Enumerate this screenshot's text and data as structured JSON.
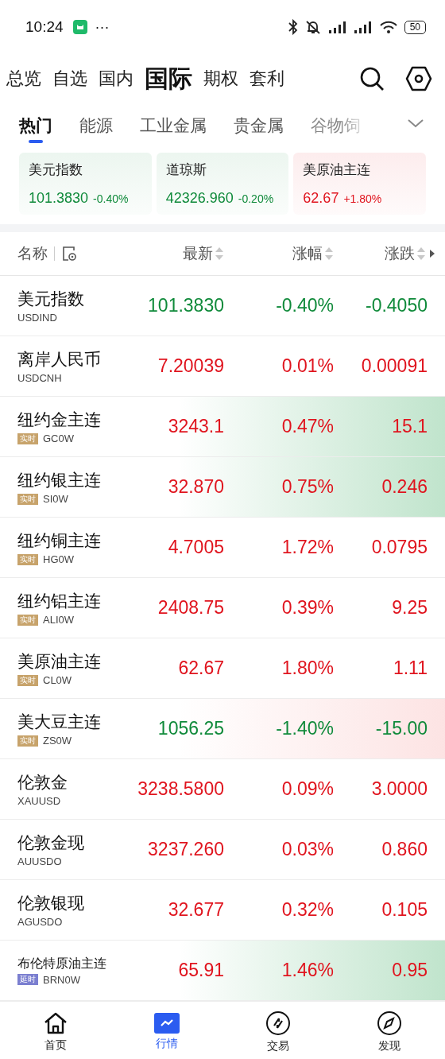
{
  "status_bar": {
    "time": "10:24",
    "more": "···",
    "battery": "50"
  },
  "top_tabs": [
    {
      "label": "总览",
      "selected": false
    },
    {
      "label": "自选",
      "selected": false
    },
    {
      "label": "国内",
      "selected": false
    },
    {
      "label": "国际",
      "selected": true
    },
    {
      "label": "期权",
      "selected": false
    },
    {
      "label": "套利",
      "selected": false
    }
  ],
  "category_tabs": [
    {
      "label": "热门",
      "selected": true
    },
    {
      "label": "能源",
      "selected": false
    },
    {
      "label": "工业金属",
      "selected": false
    },
    {
      "label": "贵金属",
      "selected": false
    },
    {
      "label": "谷物饲",
      "selected": false
    }
  ],
  "index_cards": [
    {
      "name": "美元指数",
      "price": "101.3830",
      "change": "-0.40%",
      "color": "#0f8a3a"
    },
    {
      "name": "道琼斯",
      "price": "42326.960",
      "change": "-0.20%",
      "color": "#0f8a3a"
    },
    {
      "name": "美原油主连",
      "price": "62.67",
      "change": "+1.80%",
      "color": "#e0141e"
    }
  ],
  "table": {
    "columns": [
      "名称",
      "最新",
      "涨幅",
      "涨跌"
    ],
    "rows": [
      {
        "name": "美元指数",
        "code": "USDIND",
        "price": "101.3830",
        "pct": "-0.40%",
        "change": "-0.4050",
        "color": "#0f8a3a",
        "kind": "plain"
      },
      {
        "name": "离岸人民币",
        "code": "USDCNH",
        "price": "7.20039",
        "pct": "0.01%",
        "change": "0.00091",
        "color": "#e0141e",
        "kind": "plain"
      },
      {
        "name": "纽约金主连",
        "code": "GC0W",
        "tag": {
          "text": "实时",
          "kind": "live"
        },
        "price": "3243.1",
        "pct": "0.47%",
        "change": "15.1",
        "color": "#e0141e",
        "kind": "glow"
      },
      {
        "name": "纽约银主连",
        "code": "SI0W",
        "tag": {
          "text": "实时",
          "kind": "live"
        },
        "price": "32.870",
        "pct": "0.75%",
        "change": "0.246",
        "color": "#e0141e",
        "kind": "glow"
      },
      {
        "name": "纽约铜主连",
        "code": "HG0W",
        "tag": {
          "text": "实时",
          "kind": "live"
        },
        "price": "4.7005",
        "pct": "1.72%",
        "change": "0.0795",
        "color": "#e0141e",
        "kind": "plain"
      },
      {
        "name": "纽约铝主连",
        "code": "ALI0W",
        "tag": {
          "text": "实时",
          "kind": "live"
        },
        "price": "2408.75",
        "pct": "0.39%",
        "change": "9.25",
        "color": "#e0141e",
        "kind": "plain"
      },
      {
        "name": "美原油主连",
        "code": "CL0W",
        "tag": {
          "text": "实时",
          "kind": "live"
        },
        "price": "62.67",
        "pct": "1.80%",
        "change": "1.11",
        "color": "#e0141e",
        "kind": "plain"
      },
      {
        "name": "美大豆主连",
        "code": "ZS0W",
        "tag": {
          "text": "实时",
          "kind": "live"
        },
        "price": "1056.25",
        "pct": "-1.40%",
        "change": "-15.00",
        "color": "#0f8a3a",
        "kind": "blush"
      },
      {
        "name": "伦敦金",
        "code": "XAUUSD",
        "price": "3238.5800",
        "pct": "0.09%",
        "change": "3.0000",
        "color": "#e0141e",
        "kind": "plain"
      },
      {
        "name": "伦敦金现",
        "code": "AUUSDO",
        "price": "3237.260",
        "pct": "0.03%",
        "change": "0.860",
        "color": "#e0141e",
        "kind": "plain"
      },
      {
        "name": "伦敦银现",
        "code": "AGUSDO",
        "price": "32.677",
        "pct": "0.32%",
        "change": "0.105",
        "color": "#e0141e",
        "kind": "plain"
      },
      {
        "name": "布伦特原油主连",
        "code": "BRN0W",
        "tag": {
          "text": "延时",
          "kind": "delayed"
        },
        "price": "65.91",
        "pct": "1.46%",
        "change": "0.95",
        "color": "#e0141e",
        "kind": "glow"
      }
    ]
  },
  "bottom_nav": [
    {
      "label": "首页",
      "kind": "home",
      "selected": false
    },
    {
      "label": "行情",
      "kind": "chart",
      "selected": true
    },
    {
      "label": "交易",
      "kind": "trade",
      "selected": false
    },
    {
      "label": "发现",
      "kind": "compass",
      "selected": false
    }
  ]
}
